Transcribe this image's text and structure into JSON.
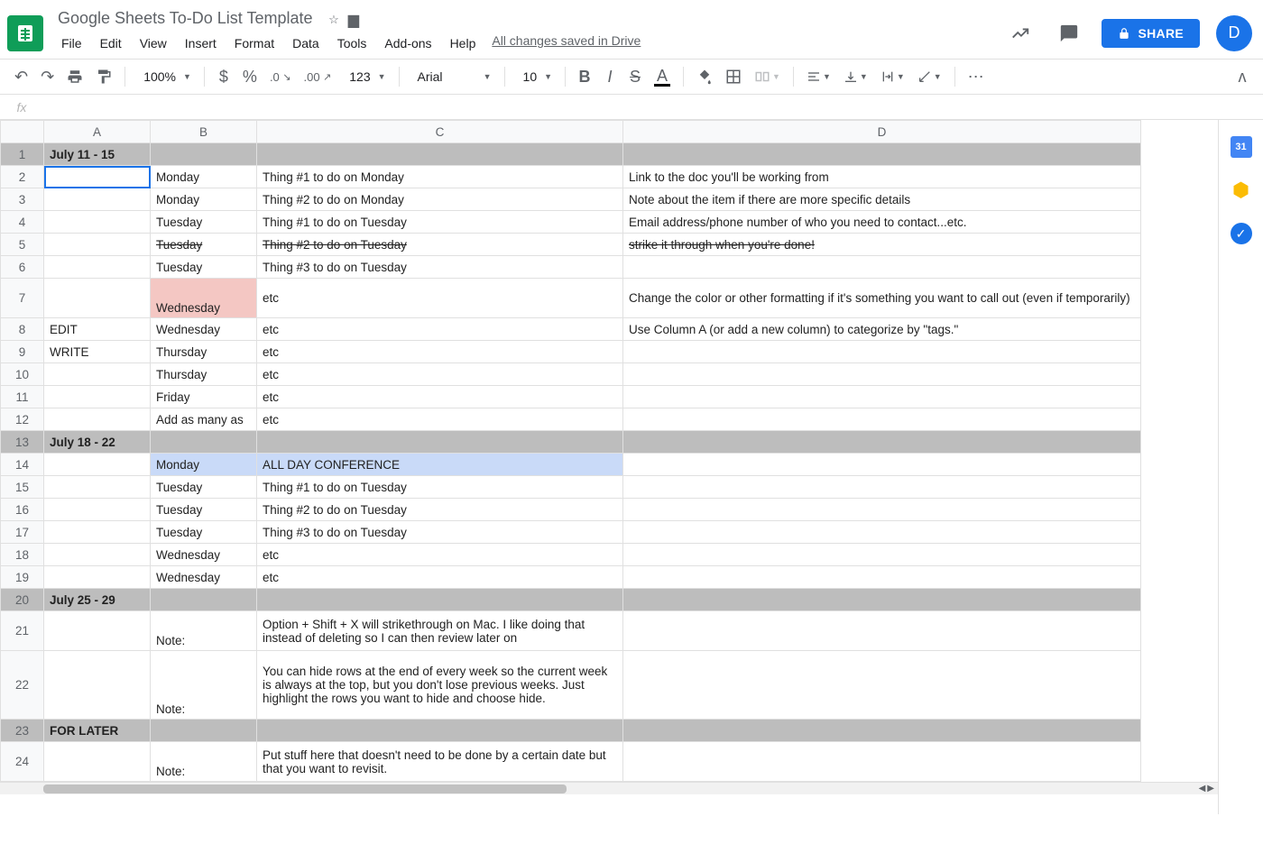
{
  "doc": {
    "title": "Google Sheets To-Do List Template",
    "saved": "All changes saved in Drive"
  },
  "menu": [
    "File",
    "Edit",
    "View",
    "Insert",
    "Format",
    "Data",
    "Tools",
    "Add-ons",
    "Help"
  ],
  "toolbar": {
    "zoom": "100%",
    "font": "Arial",
    "fontsize": "10",
    "numfmt": "123"
  },
  "share": {
    "label": "SHARE"
  },
  "avatar": {
    "letter": "D"
  },
  "columns": [
    "A",
    "B",
    "C",
    "D"
  ],
  "rows": [
    {
      "n": 1,
      "section": true,
      "a": "July 11 - 15",
      "b": "",
      "c": "",
      "d": ""
    },
    {
      "n": 2,
      "a": "",
      "b": "Monday",
      "c": "Thing #1 to do on Monday",
      "d": "Link to the doc you'll be working from",
      "active": true
    },
    {
      "n": 3,
      "a": "",
      "b": "Monday",
      "c": "Thing #2 to do on Monday",
      "d": "Note about the item if there are more specific details"
    },
    {
      "n": 4,
      "a": "",
      "b": "Tuesday",
      "c": "Thing #1 to do on Tuesday",
      "d": "Email address/phone number of who you need to contact...etc."
    },
    {
      "n": 5,
      "a": "",
      "b": "Tuesday",
      "c": "Thing #2 to do on Tuesday",
      "d": "strike it through when you're done!",
      "strike": true
    },
    {
      "n": 6,
      "a": "",
      "b": "Tuesday",
      "c": "Thing #3 to do on Tuesday",
      "d": ""
    },
    {
      "n": 7,
      "a": "",
      "b": "Wednesday",
      "c": "etc",
      "d": "Change the color or other formatting if it's something you want to call out (even if temporarily)",
      "bClass": "pink",
      "tall": true
    },
    {
      "n": 8,
      "a": "EDIT",
      "b": "Wednesday",
      "c": "etc",
      "d": "Use Column A (or add a new column) to categorize by \"tags.\""
    },
    {
      "n": 9,
      "a": "WRITE",
      "b": "Thursday",
      "c": "etc",
      "d": ""
    },
    {
      "n": 10,
      "a": "",
      "b": "Thursday",
      "c": "etc",
      "d": ""
    },
    {
      "n": 11,
      "a": "",
      "b": "Friday",
      "c": "etc",
      "d": ""
    },
    {
      "n": 12,
      "a": "",
      "b": "Add as many as",
      "c": "etc",
      "d": ""
    },
    {
      "n": 13,
      "section": true,
      "a": "July 18 - 22",
      "b": "",
      "c": "",
      "d": ""
    },
    {
      "n": 14,
      "a": "",
      "b": "Monday",
      "c": "ALL DAY CONFERENCE",
      "d": "",
      "bClass": "blue",
      "cClass": "blue"
    },
    {
      "n": 15,
      "a": "",
      "b": "Tuesday",
      "c": "Thing #1 to do on Tuesday",
      "d": ""
    },
    {
      "n": 16,
      "a": "",
      "b": "Tuesday",
      "c": "Thing #2 to do on Tuesday",
      "d": ""
    },
    {
      "n": 17,
      "a": "",
      "b": "Tuesday",
      "c": "Thing #3 to do on Tuesday",
      "d": ""
    },
    {
      "n": 18,
      "a": "",
      "b": "Wednesday",
      "c": "etc",
      "d": ""
    },
    {
      "n": 19,
      "a": "",
      "b": "Wednesday",
      "c": "etc",
      "d": ""
    },
    {
      "n": 20,
      "section": true,
      "a": "July 25 - 29",
      "b": "",
      "c": "",
      "d": ""
    },
    {
      "n": 21,
      "a": "",
      "b": "Note:",
      "c": "Option + Shift + X will strikethrough on Mac. I like doing that instead of deleting so I can then review later on",
      "d": "",
      "tall": true
    },
    {
      "n": 22,
      "a": "",
      "b": "Note:",
      "c": "You can hide rows at the end of every week so the current week is always at the top, but you don't lose previous weeks. Just highlight the rows you want to hide and choose hide.",
      "d": "",
      "tall2": true
    },
    {
      "n": 23,
      "section": true,
      "a": "FOR LATER",
      "b": "",
      "c": "",
      "d": ""
    },
    {
      "n": 24,
      "a": "",
      "b": "Note:",
      "c": "Put stuff here that doesn't need to be done by a certain date but that you want to revisit.",
      "d": "",
      "tall": true
    }
  ]
}
